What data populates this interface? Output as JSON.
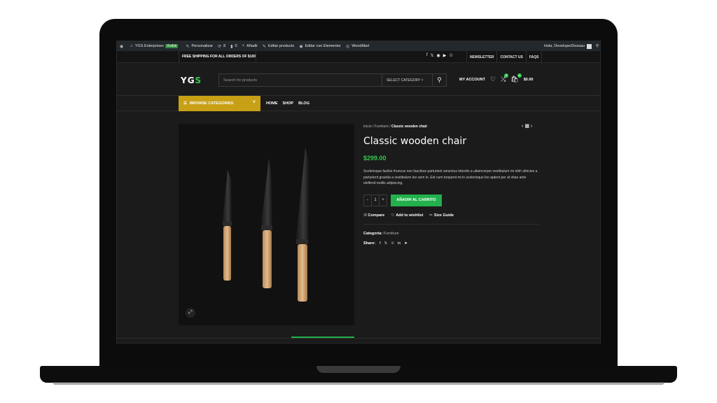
{
  "adminbar": {
    "site": "YGS Enterprises",
    "visible_badge": "Visible",
    "customize": "Personalizar",
    "updates": "8",
    "comments": "0",
    "add_new": "Añadir",
    "edit_product": "Editar producto",
    "edit_elementor": "Editar con Elementor",
    "woodmart": "WoodMart",
    "greeting": "Hola, DeveloperDossau"
  },
  "topbar": {
    "shipping": "FREE SHIPPING FOR ALL ORDERS OF $100",
    "links": [
      "NEWSLETTER",
      "CONTACT US",
      "FAQS"
    ]
  },
  "header": {
    "logo_main": "YG",
    "logo_accent": "S",
    "search_placeholder": "Search for products",
    "select_category": "SELECT CATEGORY",
    "my_account": "MY ACCOUNT",
    "compare_count": "0",
    "cart_count": "0",
    "cart_total": "$0.00"
  },
  "nav": {
    "browse": "BROWSE CATEGORIES",
    "menu": [
      "HOME",
      "SHOP",
      "BLOG"
    ]
  },
  "product": {
    "breadcrumb_home": "Inicio",
    "breadcrumb_cat": "Furniture",
    "breadcrumb_current": "Classic wooden chair",
    "title": "Classic wooden chair",
    "price": "$299.00",
    "description": "Scelerisque facilisi rhoncus non faucibus parturient senectus lobortis a ullamcorper vestibulum mi nibh ultricies a parturient gravida a vestibulum leo sem in. Est cum torquent mi in scelerisque leo aptent per at vitae ante eleifend mollis adipiscing.",
    "qty_minus": "-",
    "qty_value": "1",
    "qty_plus": "+",
    "add_to_cart": "AÑADIR AL CARRITO",
    "compare": "Compare",
    "wishlist": "Add to wishlist",
    "size_guide": "Size Guide",
    "category_label": "Categoría:",
    "category_value": "Furniture",
    "share_label": "Share:"
  },
  "colors": {
    "accent_green": "#32c94f",
    "browse_gold": "#c8a015",
    "button_green": "#22b14c"
  }
}
